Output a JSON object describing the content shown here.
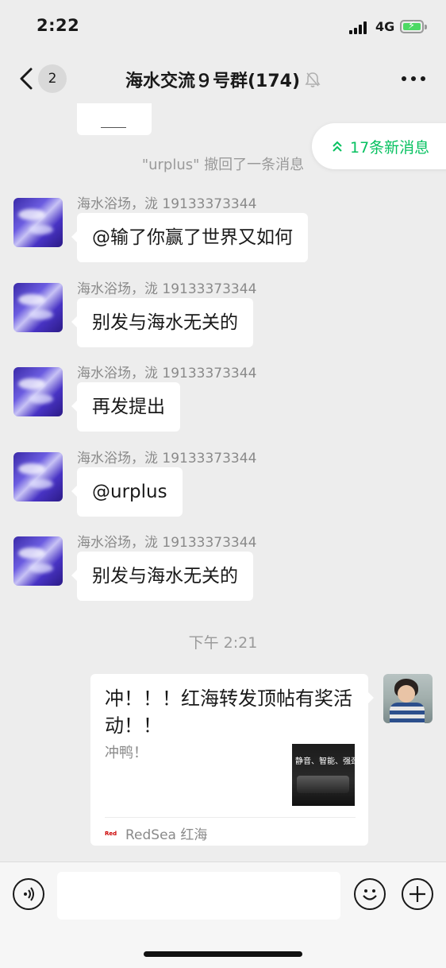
{
  "status": {
    "time": "2:22",
    "network": "4G",
    "battery_color": "#4cd964"
  },
  "nav": {
    "unread_count": "2",
    "title": "海水交流９号群(174)",
    "back_icon": "chevron-left-icon",
    "mute_icon": "bell-off-icon",
    "more_icon": "more-dots-icon"
  },
  "new_messages": {
    "label": "17条新消息",
    "icon": "double-chevron-up-icon",
    "color": "#07c160"
  },
  "system_note": "\"urplus\" 撤回了一条消息",
  "messages": [
    {
      "sender": "海水浴场，泷 19133373344",
      "text": "@输了你赢了世界又如何"
    },
    {
      "sender": "海水浴场，泷 19133373344",
      "text": "别发与海水无关的"
    },
    {
      "sender": "海水浴场，泷 19133373344",
      "text": "再发提出"
    },
    {
      "sender": "海水浴场，泷 19133373344",
      "text": "@urplus"
    },
    {
      "sender": "海水浴场，泷 19133373344",
      "text": "别发与海水无关的"
    }
  ],
  "time_divider": "下午 2:21",
  "card": {
    "title": "冲！！！红海转发顶帖有奖活动！！",
    "description": "冲鸭！",
    "thumb_caption": "静音、智能、强劲",
    "source": "RedSea 红海"
  },
  "input_bar": {
    "voice_icon": "voice-icon",
    "emoji_icon": "emoji-icon",
    "plus_icon": "plus-icon",
    "placeholder": ""
  }
}
